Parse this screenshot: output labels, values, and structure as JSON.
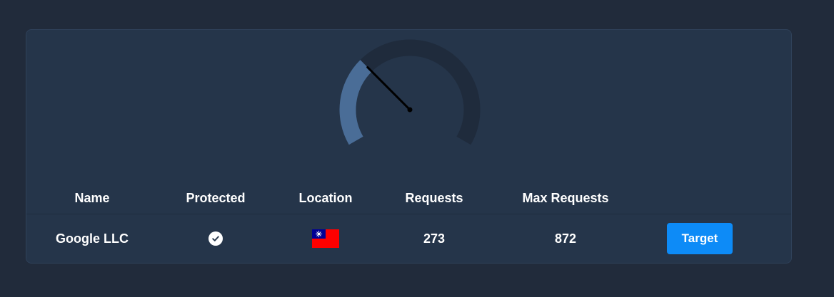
{
  "gauge": {
    "value": 273,
    "max": 872,
    "track_color": "#1f2b3c",
    "fill_color": "#4a6d97",
    "needle_color": "#000000"
  },
  "table": {
    "headers": [
      "Name",
      "Protected",
      "Location",
      "Requests",
      "Max Requests"
    ],
    "row": {
      "name": "Google LLC",
      "protected": true,
      "protected_icon": "check-circle-icon",
      "location_icon": "taiwan-flag-icon",
      "requests": "273",
      "max_requests": "872",
      "action_label": "Target"
    }
  },
  "colors": {
    "page_bg": "#212b3b",
    "card_bg": "#25354a",
    "accent": "#0d8bf7"
  }
}
